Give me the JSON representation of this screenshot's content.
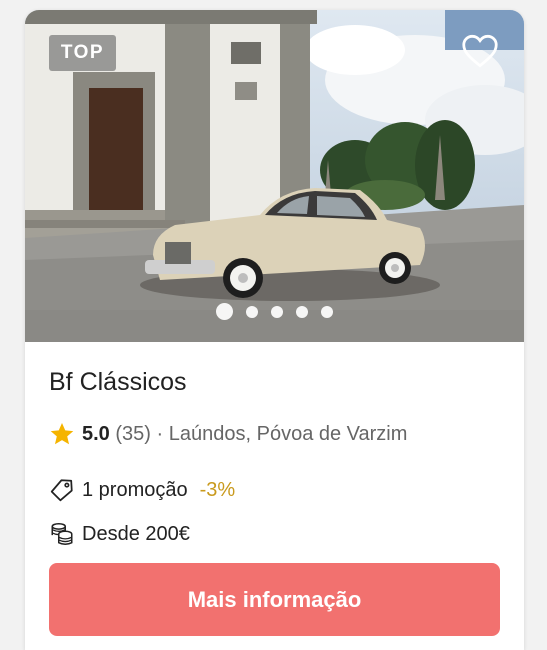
{
  "listing": {
    "badge": "TOP",
    "favorite_icon": "heart-outline-icon",
    "gallery": {
      "slides": 5,
      "active": 1
    },
    "name": "Bf Clássicos",
    "rating": {
      "icon": "star-icon",
      "value": "5.0",
      "count": "(35)",
      "separator": "·",
      "location": "Laúndos, Póvoa de Varzim"
    },
    "promotion": {
      "icon": "price-tag-icon",
      "label": "1 promoção",
      "discount": "-3%"
    },
    "price": {
      "icon": "coins-icon",
      "label": "Desde 200€"
    },
    "cta_label": "Mais informação"
  },
  "colors": {
    "cta": "#f2716f",
    "star": "#f5b400",
    "discount": "#c99a1d"
  }
}
